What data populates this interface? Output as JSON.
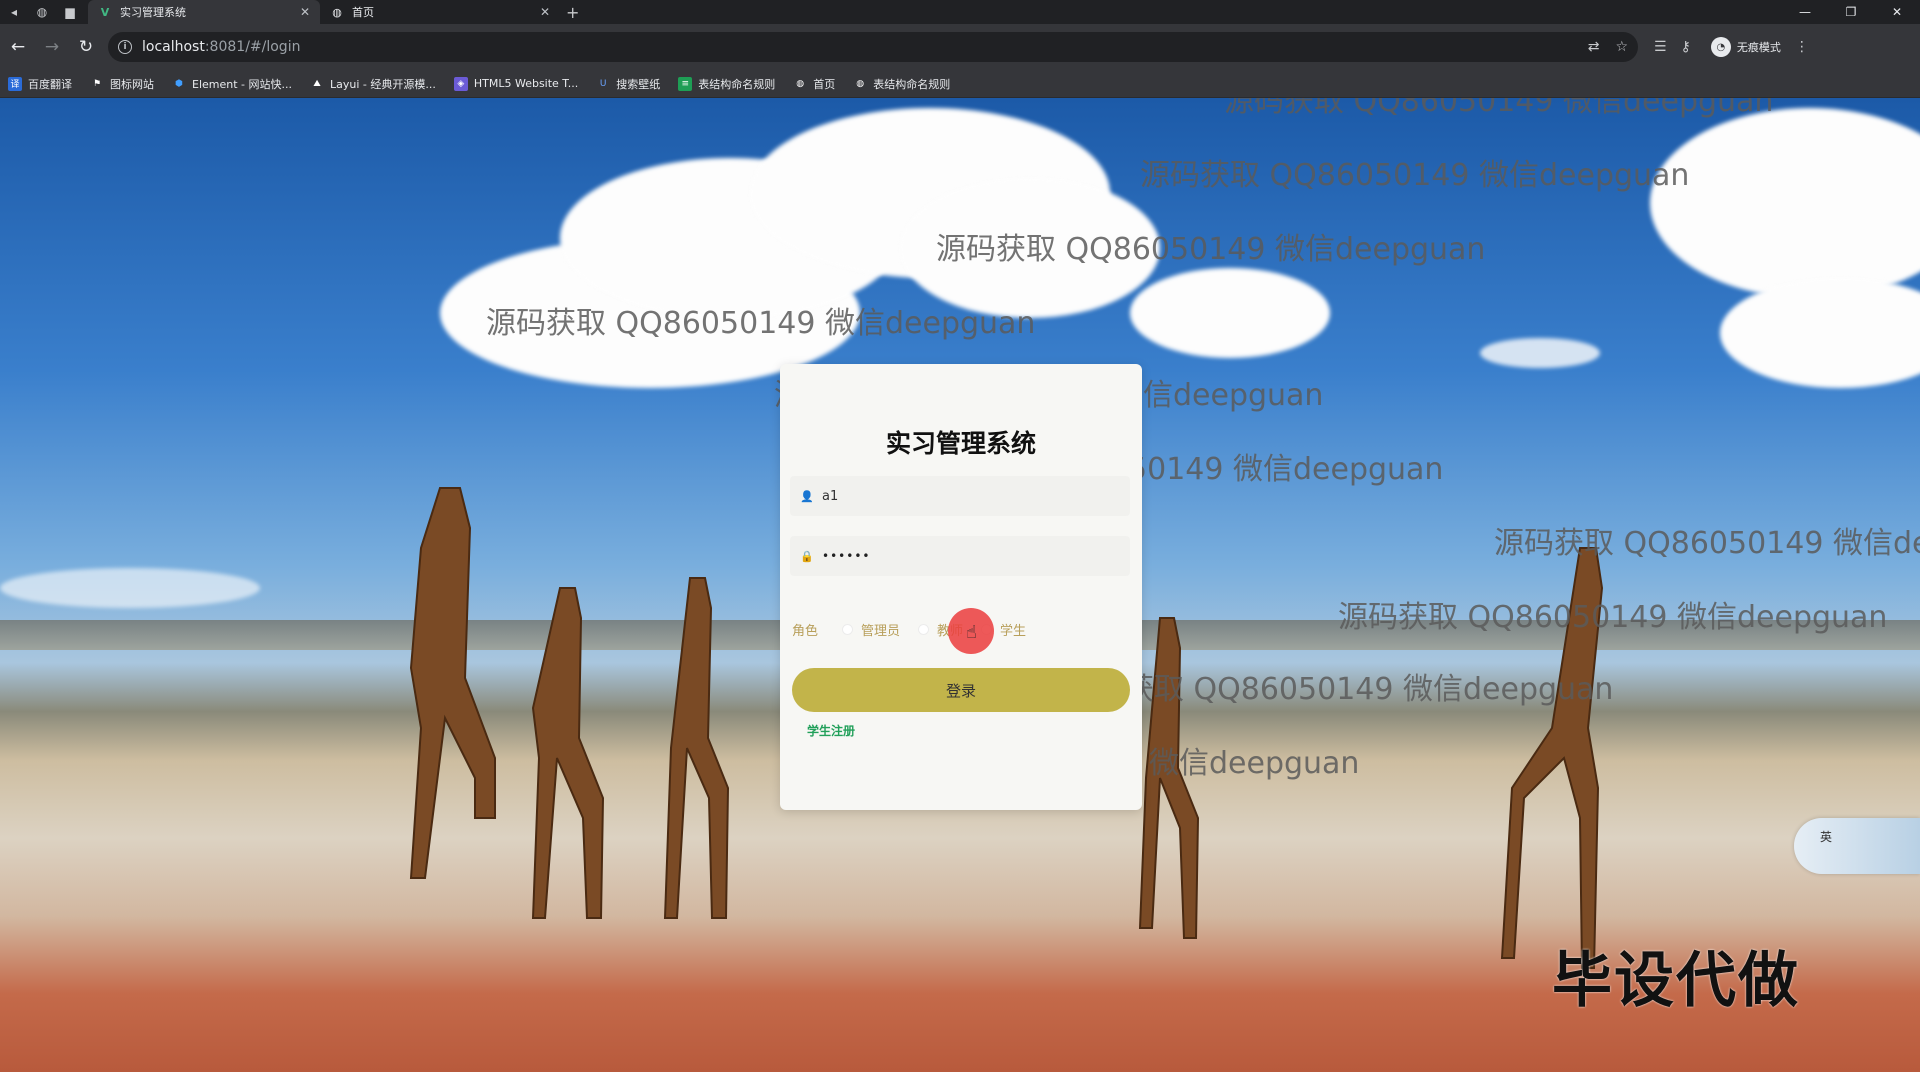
{
  "browser": {
    "tabs": [
      {
        "title": "实习管理系统",
        "active": true
      },
      {
        "title": "首页",
        "active": false
      }
    ],
    "url_host": "localhost",
    "url_rest": ":8081/#/login",
    "incognito_label": "无痕模式",
    "bookmarks": [
      "百度翻译",
      "图标网站",
      "Element - 网站快...",
      "Layui - 经典开源模...",
      "HTML5 Website T...",
      "搜索壁纸",
      "表结构命名规则",
      "首页",
      "表结构命名规则"
    ]
  },
  "login": {
    "title": "实习管理系统",
    "username_value": "a1",
    "password_value": "••••••",
    "role_label": "角色",
    "roles": [
      "管理员",
      "教师",
      "学生"
    ],
    "submit_label": "登录",
    "register_link": "学生注册"
  },
  "watermark_text": "源码获取 QQ86050149 微信deepguan",
  "overlay_text": "毕设代做",
  "ime_label": "英"
}
